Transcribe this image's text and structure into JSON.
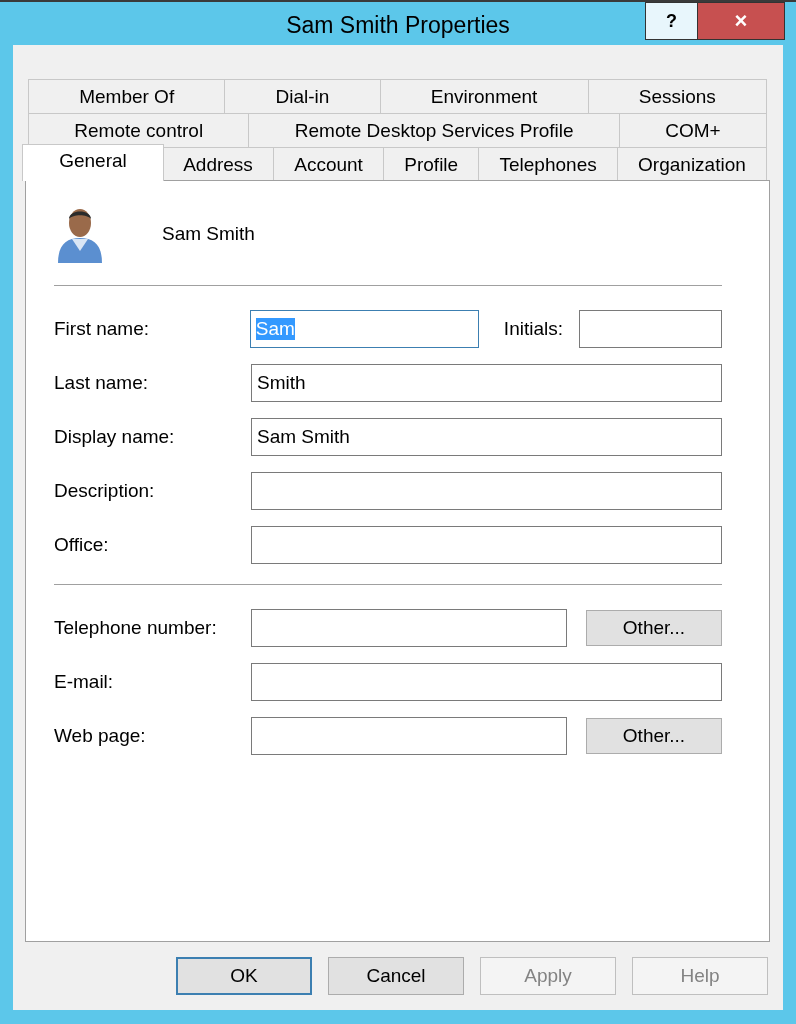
{
  "window": {
    "title": "Sam Smith Properties",
    "help_button": "?",
    "close_button": "×"
  },
  "tab_rows": [
    [
      {
        "label": "Member Of",
        "selected": false
      },
      {
        "label": "Dial-in",
        "selected": false
      },
      {
        "label": "Environment",
        "selected": false
      },
      {
        "label": "Sessions",
        "selected": false
      }
    ],
    [
      {
        "label": "Remote control",
        "selected": false
      },
      {
        "label": "Remote Desktop Services Profile",
        "selected": false
      },
      {
        "label": "COM+",
        "selected": false
      }
    ],
    [
      {
        "label": "General",
        "selected": true
      },
      {
        "label": "Address",
        "selected": false
      },
      {
        "label": "Account",
        "selected": false
      },
      {
        "label": "Profile",
        "selected": false
      },
      {
        "label": "Telephones",
        "selected": false
      },
      {
        "label": "Organization",
        "selected": false
      }
    ]
  ],
  "header": {
    "name": "Sam Smith"
  },
  "sections": [
    [
      {
        "label": "First name:",
        "value": "Sam",
        "focused": true,
        "initials_label": "Initials:"
      },
      {
        "label": "Last name:",
        "value": "Smith",
        "focused": false
      },
      {
        "label": "Display name:",
        "value": "Sam Smith",
        "focused": false
      },
      {
        "label": "Description:",
        "focused": false
      },
      {
        "label": "Office:",
        "focused": false
      }
    ],
    [
      {
        "label": "Telephone number:",
        "focused": false,
        "button": "Other..."
      },
      {
        "label": "E-mail:",
        "focused": false
      },
      {
        "label": "Web page:",
        "focused": false,
        "button": "Other..."
      }
    ]
  ],
  "buttons": [
    {
      "label": "OK",
      "default": true,
      "disabled": false
    },
    {
      "label": "Cancel",
      "default": false,
      "disabled": false
    },
    {
      "label": "Apply",
      "default": false,
      "disabled": true
    },
    {
      "label": "Help",
      "default": false,
      "disabled": true
    }
  ]
}
